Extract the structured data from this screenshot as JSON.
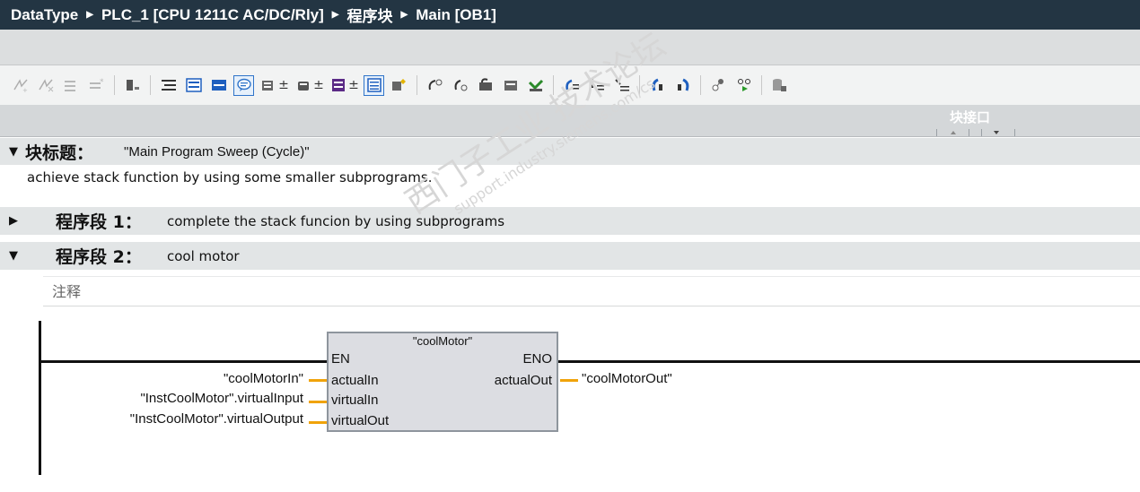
{
  "breadcrumb": {
    "items": [
      "DataType",
      "PLC_1 [CPU 1211C AC/DC/Rly]",
      "程序块",
      "Main [OB1]"
    ]
  },
  "toolbar": {
    "icons": [
      "insert-network-icon",
      "delete-network-icon",
      "insert-row-icon",
      "add-row-icon",
      "symbol-icon",
      "absolute-icon",
      "expand-all-icon",
      "collapse-all-icon",
      "network-comment-icon",
      "favorites-icon",
      "call-icon",
      "box-icon",
      "empty-box-icon",
      "step-icon",
      "monitor-icon",
      "open-branch-icon",
      "close-branch-icon",
      "connect-icon",
      "goto-icon",
      "jump-icon",
      "return-icon",
      "cross-reference-icon",
      "assignment-icon",
      "database-icon"
    ]
  },
  "interface_panel": {
    "label": "块接口"
  },
  "block_title": {
    "label": "块标题：",
    "value": "\"Main Program Sweep (Cycle)\"",
    "comment": "achieve stack function by using some smaller subprograms."
  },
  "networks": [
    {
      "label": "程序段 1：",
      "title": "complete the stack funcion by using subprograms",
      "collapsed": true
    },
    {
      "label": "程序段 2：",
      "title": "cool motor",
      "collapsed": false,
      "comment_placeholder": "注释"
    }
  ],
  "function_block": {
    "name": "\"coolMotor\"",
    "en": "EN",
    "eno": "ENO",
    "inputs": [
      {
        "pin": "actualIn",
        "operand": "\"coolMotorIn\""
      },
      {
        "pin": "virtualIn",
        "operand": "\"InstCoolMotor\".virtualInput"
      },
      {
        "pin": "virtualOut",
        "operand": "\"InstCoolMotor\".virtualOutput"
      }
    ],
    "outputs": [
      {
        "pin": "actualOut",
        "operand": "\"coolMotorOut\""
      }
    ]
  },
  "watermark": {
    "text": "西门子工业 技术论坛",
    "url": "support.industry.siemens.com/cs"
  },
  "colors": {
    "title_bg": "#233543",
    "pin_stub": "#f0a30a",
    "active_tool": "#2f74c9"
  }
}
